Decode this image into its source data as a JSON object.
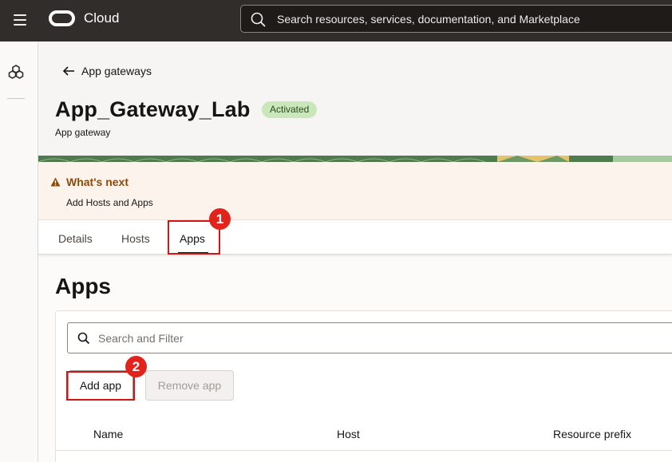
{
  "topbar": {
    "brand": "Cloud",
    "search_placeholder": "Search resources, services, documentation, and Marketplace"
  },
  "header": {
    "back_label": "App gateways",
    "title": "App_Gateway_Lab",
    "status_badge": "Activated",
    "subtitle": "App gateway"
  },
  "whats_next": {
    "title": "What's next",
    "text": "Add Hosts and Apps"
  },
  "tabs": [
    {
      "label": "Details"
    },
    {
      "label": "Hosts"
    },
    {
      "label": "Apps",
      "active": true
    }
  ],
  "annotations": {
    "step1": "1",
    "step2": "2",
    "highlight_color": "#d01515",
    "marker_color": "#e3231b"
  },
  "main": {
    "title": "Apps",
    "filter_placeholder": "Search and Filter",
    "add_button": "Add app",
    "remove_button": "Remove app",
    "columns": [
      "Name",
      "Host",
      "Resource prefix"
    ]
  },
  "colors": {
    "topbar_bg": "#312d2a",
    "badge_bg": "#c9e7b8",
    "warning_text": "#8a4b0a"
  }
}
